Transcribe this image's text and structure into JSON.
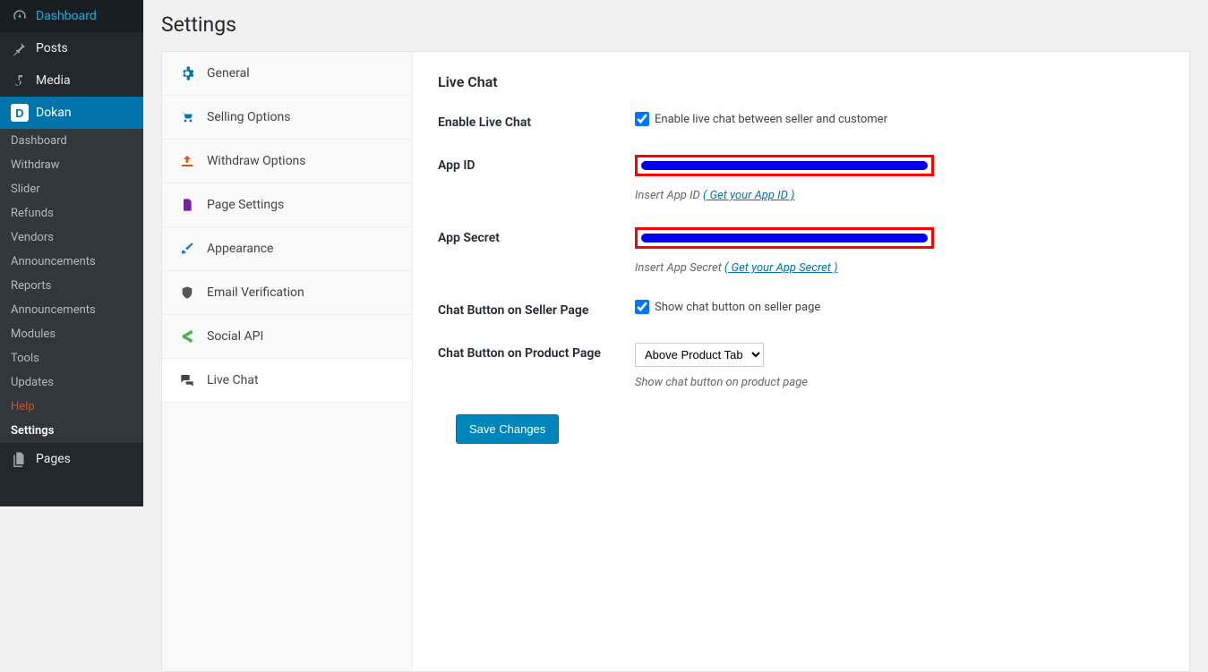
{
  "sidebar": {
    "items": [
      {
        "label": "Dashboard",
        "icon": "dashboard"
      },
      {
        "label": "Posts",
        "icon": "pin"
      },
      {
        "label": "Media",
        "icon": "media"
      },
      {
        "label": "Dokan",
        "icon": "dokan"
      },
      {
        "label": "Pages",
        "icon": "pages"
      }
    ],
    "sub": [
      {
        "label": "Dashboard"
      },
      {
        "label": "Withdraw"
      },
      {
        "label": "Slider"
      },
      {
        "label": "Refunds"
      },
      {
        "label": "Vendors"
      },
      {
        "label": "Announcements"
      },
      {
        "label": "Reports"
      },
      {
        "label": "Announcements"
      },
      {
        "label": "Modules"
      },
      {
        "label": "Tools"
      },
      {
        "label": "Updates"
      },
      {
        "label": "Help"
      },
      {
        "label": "Settings"
      }
    ]
  },
  "page": {
    "title": "Settings"
  },
  "tabs": [
    {
      "label": "General",
      "icon": "gear",
      "color": "#0073aa"
    },
    {
      "label": "Selling Options",
      "icon": "cart",
      "color": "#0073aa"
    },
    {
      "label": "Withdraw Options",
      "icon": "withdraw",
      "color": "#e65100"
    },
    {
      "label": "Page Settings",
      "icon": "page",
      "color": "#7b1fa2"
    },
    {
      "label": "Appearance",
      "icon": "brush",
      "color": "#1976d2"
    },
    {
      "label": "Email Verification",
      "icon": "shield",
      "color": "#555"
    },
    {
      "label": "Social API",
      "icon": "share",
      "color": "#4caf50"
    },
    {
      "label": "Live Chat",
      "icon": "chat",
      "color": "#444"
    }
  ],
  "form": {
    "section_title": "Live Chat",
    "enable": {
      "label": "Enable Live Chat",
      "cb_label": "Enable live chat between seller and customer",
      "checked": true
    },
    "appid": {
      "label": "App ID",
      "hint_prefix": "Insert App ID ",
      "hint_link": "( Get your App ID )"
    },
    "appsecret": {
      "label": "App Secret",
      "hint_prefix": "Insert App Secret ",
      "hint_link": "( Get your App Secret )"
    },
    "seller_btn": {
      "label": "Chat Button on Seller Page",
      "cb_label": "Show chat button on seller page",
      "checked": true
    },
    "product_btn": {
      "label": "Chat Button on Product Page",
      "selected": "Above Product Tab",
      "hint": "Show chat button on product page"
    },
    "save_label": "Save Changes"
  }
}
